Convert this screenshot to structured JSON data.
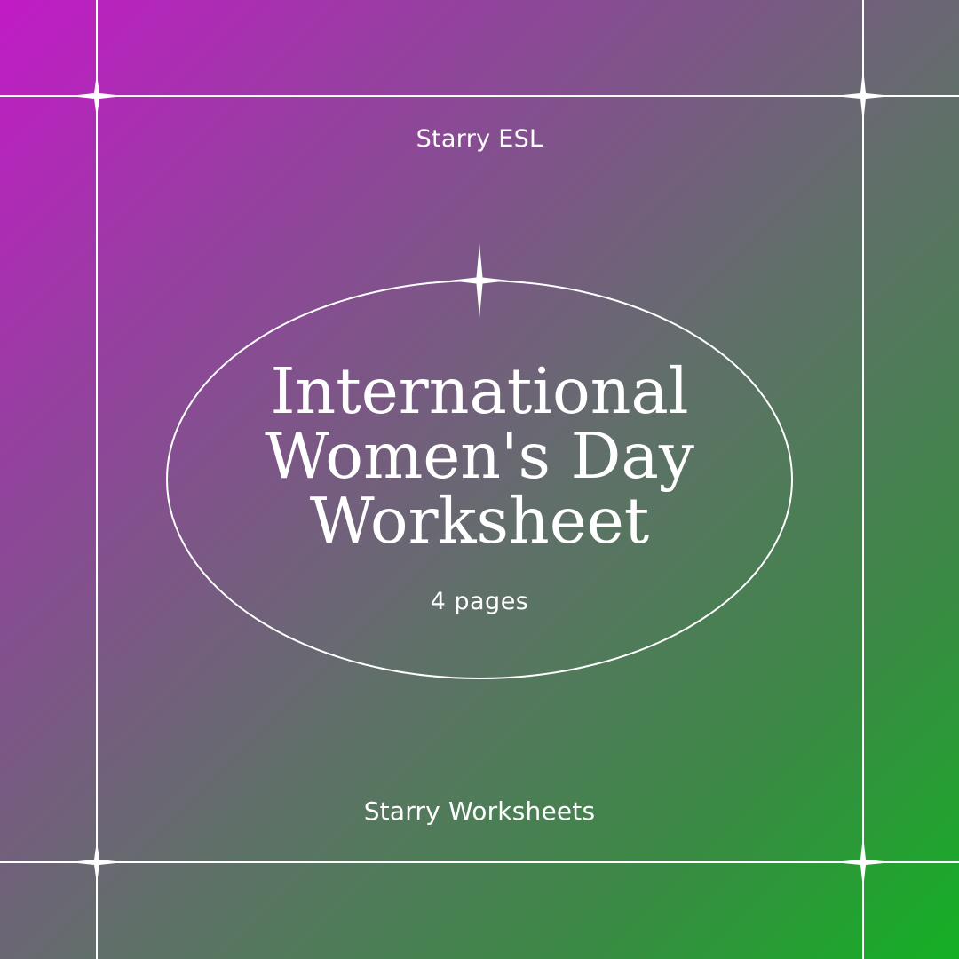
{
  "brand_top": "Starry ESL",
  "title_lines": [
    "International",
    "Women's Day",
    "Worksheet"
  ],
  "subtitle": "4 pages",
  "brand_bottom": "Starry Worksheets",
  "colors": {
    "gradient_start": "#c21ac7",
    "gradient_end": "#14b024",
    "line": "#ffffff"
  }
}
